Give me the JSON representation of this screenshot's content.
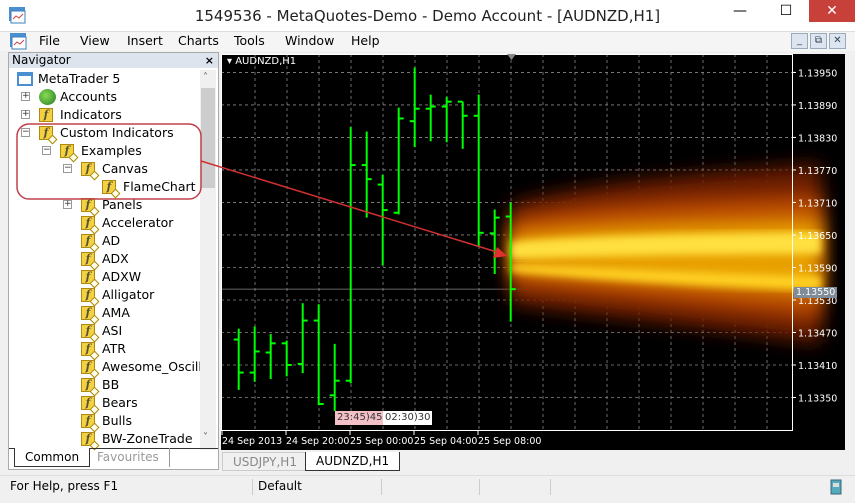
{
  "window": {
    "title": "1549536 - MetaQuotes-Demo - Demo Account - [AUDNZD,H1]",
    "minimize": "—",
    "maximize": "☐",
    "close": "✕"
  },
  "menu": [
    "File",
    "View",
    "Insert",
    "Charts",
    "Tools",
    "Window",
    "Help"
  ],
  "mdi": {
    "minimize": "_",
    "restore": "⧉",
    "close": "✕"
  },
  "navigator": {
    "title": "Navigator",
    "close": "×",
    "items": [
      {
        "label": "MetaTrader 5",
        "icon": "terminal-icon",
        "level": 0
      },
      {
        "label": "Accounts",
        "icon": "accounts-icon",
        "level": 1,
        "expander": "+"
      },
      {
        "label": "Indicators",
        "icon": "indicator-icon",
        "level": 1,
        "expander": "+"
      },
      {
        "label": "Custom Indicators",
        "icon": "custom-indicator-icon",
        "level": 1,
        "expander": "-"
      },
      {
        "label": "Examples",
        "icon": "custom-indicator-icon",
        "level": 2,
        "expander": "-"
      },
      {
        "label": "Canvas",
        "icon": "custom-indicator-icon",
        "level": 3,
        "expander": "-"
      },
      {
        "label": "FlameChart",
        "icon": "custom-indicator-icon",
        "level": 4
      },
      {
        "label": "Panels",
        "icon": "custom-indicator-icon",
        "level": 3,
        "expander": "+"
      },
      {
        "label": "Accelerator",
        "icon": "custom-indicator-icon",
        "level": 3
      },
      {
        "label": "AD",
        "icon": "custom-indicator-icon",
        "level": 3
      },
      {
        "label": "ADX",
        "icon": "custom-indicator-icon",
        "level": 3
      },
      {
        "label": "ADXW",
        "icon": "custom-indicator-icon",
        "level": 3
      },
      {
        "label": "Alligator",
        "icon": "custom-indicator-icon",
        "level": 3
      },
      {
        "label": "AMA",
        "icon": "custom-indicator-icon",
        "level": 3
      },
      {
        "label": "ASI",
        "icon": "custom-indicator-icon",
        "level": 3
      },
      {
        "label": "ATR",
        "icon": "custom-indicator-icon",
        "level": 3
      },
      {
        "label": "Awesome_Oscillat",
        "icon": "custom-indicator-icon",
        "level": 3
      },
      {
        "label": "BB",
        "icon": "custom-indicator-icon",
        "level": 3
      },
      {
        "label": "Bears",
        "icon": "custom-indicator-icon",
        "level": 3
      },
      {
        "label": "Bulls",
        "icon": "custom-indicator-icon",
        "level": 3
      },
      {
        "label": "BW-ZoneTrade",
        "icon": "custom-indicator-icon",
        "level": 3
      }
    ],
    "tabs": [
      {
        "label": "Common",
        "active": true
      },
      {
        "label": "Favourites",
        "active": false
      }
    ]
  },
  "chart": {
    "symbol_label": "AUDNZD,H1",
    "bar_color": "#00ff00",
    "arrow_color": "#d03030",
    "highlight_color": "#c0404a",
    "current_price": "1.13550",
    "time_markers": [
      "23:45",
      ")45",
      "02:30",
      ")30"
    ],
    "tabs": [
      {
        "label": "USDJPY,H1",
        "active": false
      },
      {
        "label": "AUDNZD,H1",
        "active": true
      }
    ]
  },
  "chart_data": {
    "type": "ohlc",
    "ylim": [
      1.1329,
      1.13984
    ],
    "yticks": [
      "1.13950",
      "1.13890",
      "1.13830",
      "1.13770",
      "1.13710",
      "1.13650",
      "1.13590",
      "1.13530",
      "1.13470",
      "1.13410",
      "1.13350"
    ],
    "xticks": [
      "24 Sep 2013",
      "24 Sep 20:00",
      "25 Sep 00:00",
      "25 Sep 04:00",
      "25 Sep 08:00"
    ],
    "grid": true,
    "bars": [
      {
        "o": 1.13457,
        "h": 1.13477,
        "l": 1.13364,
        "c": 1.13396
      },
      {
        "o": 1.13396,
        "h": 1.13481,
        "l": 1.13379,
        "c": 1.13435
      },
      {
        "o": 1.13433,
        "h": 1.13467,
        "l": 1.13384,
        "c": 1.1345
      },
      {
        "o": 1.1345,
        "h": 1.13455,
        "l": 1.13389,
        "c": 1.1341
      },
      {
        "o": 1.13412,
        "h": 1.13524,
        "l": 1.13395,
        "c": 1.13492
      },
      {
        "o": 1.13492,
        "h": 1.13522,
        "l": 1.13336,
        "c": 1.13338
      },
      {
        "o": 1.13354,
        "h": 1.13449,
        "l": 1.13325,
        "c": 1.13381
      },
      {
        "o": 1.13381,
        "h": 1.13849,
        "l": 1.13376,
        "c": 1.13779
      },
      {
        "o": 1.13779,
        "h": 1.13841,
        "l": 1.13682,
        "c": 1.13753
      },
      {
        "o": 1.13743,
        "h": 1.13761,
        "l": 1.13594,
        "c": 1.13696
      },
      {
        "o": 1.13691,
        "h": 1.13885,
        "l": 1.13688,
        "c": 1.13865
      },
      {
        "o": 1.1386,
        "h": 1.13959,
        "l": 1.13812,
        "c": 1.13883
      },
      {
        "o": 1.13883,
        "h": 1.13909,
        "l": 1.13823,
        "c": 1.13887
      },
      {
        "o": 1.13887,
        "h": 1.13905,
        "l": 1.13821,
        "c": 1.13896
      },
      {
        "o": 1.13896,
        "h": 1.13896,
        "l": 1.13809,
        "c": 1.1387
      },
      {
        "o": 1.1387,
        "h": 1.13909,
        "l": 1.13628,
        "c": 1.13654
      },
      {
        "o": 1.13653,
        "h": 1.13697,
        "l": 1.13578,
        "c": 1.13682
      },
      {
        "o": 1.13684,
        "h": 1.1371,
        "l": 1.1349,
        "c": 1.1355
      }
    ]
  },
  "status": {
    "help": "For Help, press F1",
    "profile": "Default"
  }
}
